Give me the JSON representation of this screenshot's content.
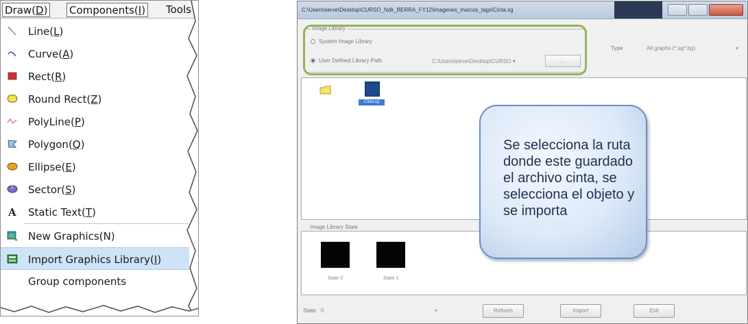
{
  "menu": {
    "menubar": [
      {
        "text": "Draw(",
        "mnemonic": "D",
        "suffix": ")"
      },
      {
        "text": "Components(",
        "mnemonic": "I",
        "suffix": ")"
      },
      {
        "text": "Tools",
        "mnemonic": "",
        "suffix": ""
      }
    ],
    "items": [
      {
        "pre": "Line(",
        "mnemonic": "L",
        "post": ")",
        "icon": "line-icon"
      },
      {
        "pre": "Curve(",
        "mnemonic": "A",
        "post": ")",
        "icon": "curve-icon"
      },
      {
        "pre": "Rect(",
        "mnemonic": "R",
        "post": ")",
        "icon": "rect-icon"
      },
      {
        "pre": "Round Rect(",
        "mnemonic": "Z",
        "post": ")",
        "icon": "round-rect-icon"
      },
      {
        "pre": "PolyLine(",
        "mnemonic": "P",
        "post": ")",
        "icon": "polyline-icon"
      },
      {
        "pre": "Polygon(",
        "mnemonic": "Q",
        "post": ")",
        "icon": "polygon-icon"
      },
      {
        "pre": "Ellipse(",
        "mnemonic": "E",
        "post": ")",
        "icon": "ellipse-icon"
      },
      {
        "pre": "Sector(",
        "mnemonic": "S",
        "post": ")",
        "icon": "sector-icon"
      },
      {
        "pre": "Static Text(",
        "mnemonic": "T",
        "post": ")",
        "icon": "static-text-icon"
      },
      {
        "pre": "New Graphics(N)",
        "mnemonic": "",
        "post": "",
        "icon": "new-graphics-icon"
      },
      {
        "pre": "Import Graphics Library(",
        "mnemonic": "I",
        "post": ")",
        "icon": "import-graphics-icon"
      },
      {
        "pre": "Group components",
        "mnemonic": "",
        "post": "",
        "icon": "group-icon"
      }
    ],
    "highlighted_index": 10,
    "colors": {
      "highlight": "#cfe3f8",
      "rect_red": "#c8323c",
      "round_rect_yellow": "#f3e24a",
      "ellipse_orange": "#e7a31c",
      "sector_purple": "#7a6fc6"
    }
  },
  "dialog": {
    "title": "C:\\Users\\serve\\Desktop\\CURSO_Ndk_BERRA_FY12\\imagenes_marcos_tags\\Cinta.sg",
    "group_label": "Image Library",
    "option_system": "System Image Library",
    "option_user": "User Defined Library Path",
    "selected_option": "user",
    "path_value": "C:\\Users\\serve\\Desktop\\CURSO",
    "browse_label": "...",
    "type_label": "Type",
    "type_value": "All graphs (*.sg*.bg)",
    "file_name": "Cinta.sg",
    "state_caption": "Image Library State",
    "states": [
      "State 0",
      "State 1"
    ],
    "state_label": "State",
    "state_value": "0",
    "buttons": {
      "refresh": "Refresh",
      "import": "Import",
      "exit": "Exit"
    },
    "colors": {
      "outline": "#8fb55a",
      "file_selected": "#3d79d6",
      "thumb": "#1c4a8a"
    }
  },
  "callout": {
    "text": "Se selecciona la ruta donde este guardado el archivo cinta, se selecciona el objeto y se importa"
  }
}
